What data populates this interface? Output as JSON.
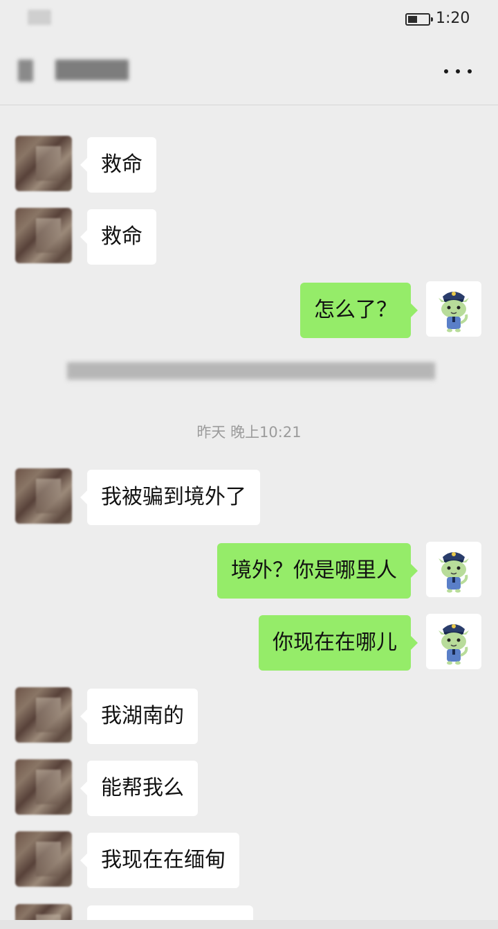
{
  "status_bar": {
    "time": "1:20"
  },
  "messages": [
    {
      "side": "left",
      "text": "救命"
    },
    {
      "side": "left",
      "text": "救命"
    },
    {
      "side": "right",
      "text": "怎么了？"
    },
    {
      "side": "left",
      "text": "我被骗到境外了"
    },
    {
      "side": "right",
      "text": "境外？你是哪里人"
    },
    {
      "side": "right",
      "text": "你现在在哪儿"
    },
    {
      "side": "left",
      "text": "我湖南的"
    },
    {
      "side": "left",
      "text": "能帮我么"
    },
    {
      "side": "left",
      "text": "我现在在缅甸"
    }
  ],
  "timestamp": "昨天 晚上10:21",
  "colors": {
    "background": "#ededed",
    "self_bubble": "#95ec69",
    "other_bubble": "#ffffff"
  }
}
